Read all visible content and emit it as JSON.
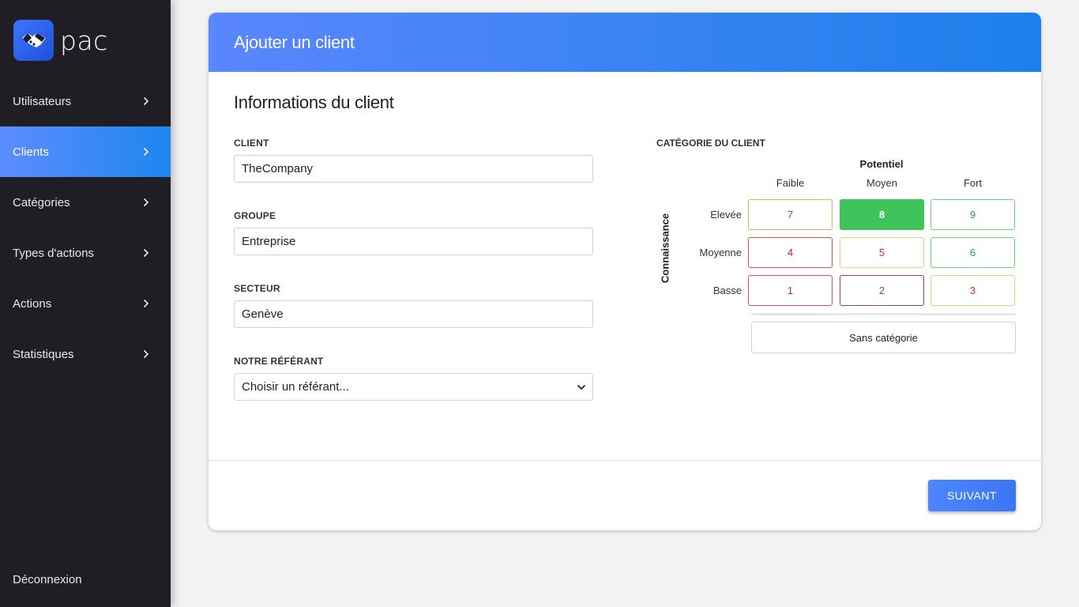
{
  "app": {
    "brand": "pac",
    "logo_icon": "handshake-icon"
  },
  "sidebar": {
    "items": [
      {
        "label": "Utilisateurs",
        "active": false
      },
      {
        "label": "Clients",
        "active": true
      },
      {
        "label": "Catégories",
        "active": false
      },
      {
        "label": "Types d'actions",
        "active": false
      },
      {
        "label": "Actions",
        "active": false
      },
      {
        "label": "Statistiques",
        "active": false
      }
    ],
    "logout": "Déconnexion"
  },
  "card": {
    "title": "Ajouter un client",
    "section_title": "Informations du client"
  },
  "form": {
    "client": {
      "label": "CLIENT",
      "value": "TheCompany"
    },
    "groupe": {
      "label": "GROUPE",
      "value": "Entreprise"
    },
    "secteur": {
      "label": "SECTEUR",
      "value": "Genève"
    },
    "referant": {
      "label": "NOTRE RÉFÉRANT",
      "value": "Choisir un référant..."
    }
  },
  "category": {
    "label": "CATÉGORIE DU CLIENT",
    "x_axis_title": "Potentiel",
    "y_axis_title": "Connaissance",
    "columns": [
      "Faible",
      "Moyen",
      "Fort"
    ],
    "rows": [
      "Elevée",
      "Moyenne",
      "Basse"
    ],
    "cells": [
      [
        "7",
        "8",
        "9"
      ],
      [
        "4",
        "5",
        "6"
      ],
      [
        "1",
        "2",
        "3"
      ]
    ],
    "selected": "8",
    "none_label": "Sans catégorie",
    "colors": {
      "red": "#d9534f",
      "orange": "#f0ad4e",
      "green": "#3ec45a"
    }
  },
  "actions": {
    "next_label": "SUIVANT"
  }
}
